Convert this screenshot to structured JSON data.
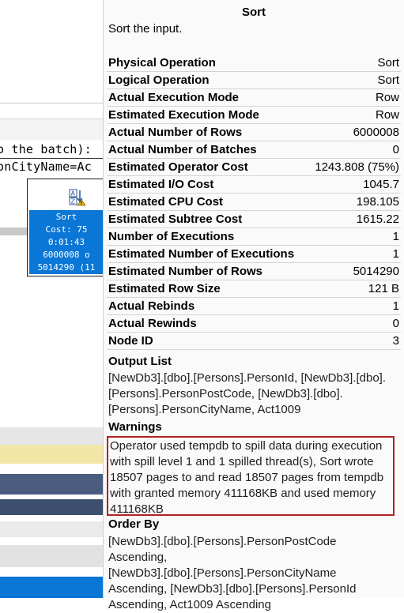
{
  "plan": {
    "query_lines": [
      "o the batch):",
      "onCityName=Ac"
    ],
    "node": {
      "title": "Sort",
      "lines": [
        "Cost: 75",
        "0:01:43",
        "6000008 o",
        "5014290 (11"
      ]
    }
  },
  "tooltip": {
    "title": "Sort",
    "description": "Sort the input.",
    "properties": [
      {
        "key": "Physical Operation",
        "value": "Sort"
      },
      {
        "key": "Logical Operation",
        "value": "Sort"
      },
      {
        "key": "Actual Execution Mode",
        "value": "Row"
      },
      {
        "key": "Estimated Execution Mode",
        "value": "Row"
      },
      {
        "key": "Actual Number of Rows",
        "value": "6000008"
      },
      {
        "key": "Actual Number of Batches",
        "value": "0"
      },
      {
        "key": "Estimated Operator Cost",
        "value": "1243.808 (75%)"
      },
      {
        "key": "Estimated I/O Cost",
        "value": "1045.7"
      },
      {
        "key": "Estimated CPU Cost",
        "value": "198.105"
      },
      {
        "key": "Estimated Subtree Cost",
        "value": "1615.22"
      },
      {
        "key": "Number of Executions",
        "value": "1"
      },
      {
        "key": "Estimated Number of Executions",
        "value": "1"
      },
      {
        "key": "Estimated Number of Rows",
        "value": "5014290"
      },
      {
        "key": "Estimated Row Size",
        "value": "121 B"
      },
      {
        "key": "Actual Rebinds",
        "value": "1"
      },
      {
        "key": "Actual Rewinds",
        "value": "0"
      },
      {
        "key": "Node ID",
        "value": "3"
      }
    ],
    "output_list": {
      "title": "Output List",
      "lines": [
        "[NewDb3].[dbo].[Persons].PersonId, [NewDb3].[dbo].",
        "[Persons].PersonPostCode, [NewDb3].[dbo].",
        "[Persons].PersonCityName, Act1009"
      ]
    },
    "warnings": {
      "title": "Warnings",
      "lines": [
        "Operator used tempdb to spill data during execution",
        "with spill level 1 and 1 spilled thread(s), Sort wrote",
        "18507 pages to and read 18507 pages from tempdb",
        "with granted memory 411168KB and used memory",
        "411168KB"
      ]
    },
    "order_by": {
      "title": "Order By",
      "lines": [
        "[NewDb3].[dbo].[Persons].PersonPostCode Ascending,",
        "[NewDb3].[dbo].[Persons].PersonCityName",
        "Ascending, [NewDb3].[dbo].[Persons].PersonId",
        "Ascending, Act1009 Ascending"
      ]
    }
  },
  "colors": {
    "node_selected": "#0a76d6",
    "warning_border": "#b22222",
    "warning_icon": "#f0c419"
  }
}
